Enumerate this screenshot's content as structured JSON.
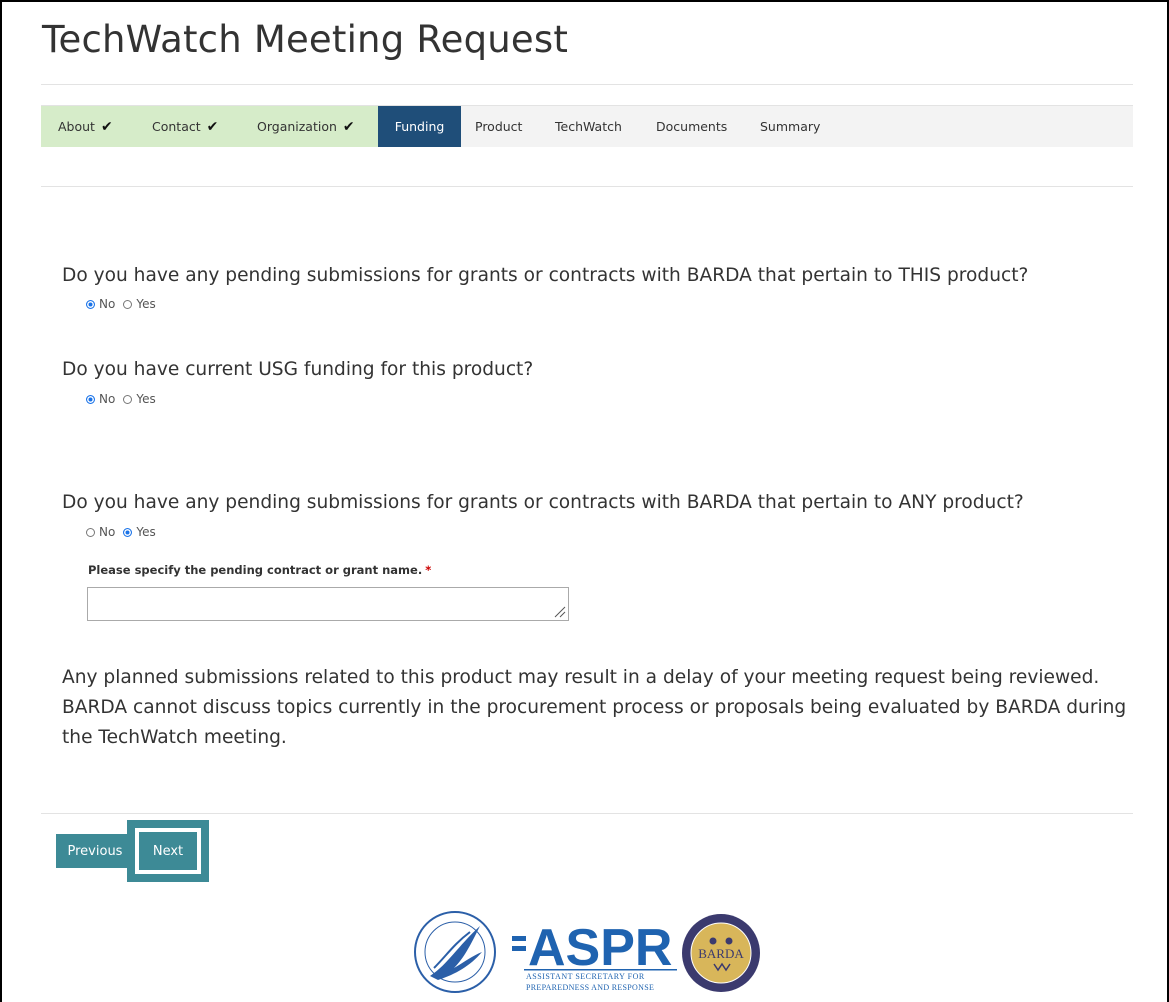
{
  "page": {
    "title": "TechWatch Meeting Request"
  },
  "steps": [
    {
      "label": "About",
      "state": "done"
    },
    {
      "label": "Contact",
      "state": "done"
    },
    {
      "label": "Organization",
      "state": "done"
    },
    {
      "label": "Funding",
      "state": "active"
    },
    {
      "label": "Product",
      "state": "pending"
    },
    {
      "label": "TechWatch",
      "state": "pending"
    },
    {
      "label": "Documents",
      "state": "pending"
    },
    {
      "label": "Summary",
      "state": "pending"
    }
  ],
  "check_glyph": "✔",
  "questions": [
    {
      "text": "Do you have any pending submissions for grants or contracts with BARDA that pertain to THIS product?",
      "options": [
        "No",
        "Yes"
      ],
      "selected": "No"
    },
    {
      "text": "Do you have current USG funding for this product?",
      "options": [
        "No",
        "Yes"
      ],
      "selected": "No"
    },
    {
      "text": "Do you have any pending submissions for grants or contracts with BARDA that pertain to ANY product?",
      "options": [
        "No",
        "Yes"
      ],
      "selected": "Yes"
    }
  ],
  "pending_name_field": {
    "label": "Please specify the pending contract or grant name.",
    "required_marker": "*",
    "value": ""
  },
  "notice": "Any planned submissions related to this product may result in a delay of your meeting request being reviewed. BARDA cannot discuss topics currently in the procurement process or proposals being evaluated by BARDA during the TechWatch meeting.",
  "buttons": {
    "previous": "Previous",
    "next": "Next"
  },
  "footer_logos": {
    "aspr_text": "ASPR",
    "aspr_subtitle_1": "ASSISTANT SECRETARY FOR",
    "aspr_subtitle_2": "PREPAREDNESS AND RESPONSE",
    "barda_text": "BARDA",
    "hhs_seal_icon": "hhs-eagle-seal"
  },
  "colors": {
    "step_done": "#d6ecc9",
    "step_active": "#1f4e79",
    "button": "#3d8a96",
    "radio_checked": "#1a73e8",
    "required": "#cc0000",
    "aspr_blue": "#1f63b0"
  }
}
